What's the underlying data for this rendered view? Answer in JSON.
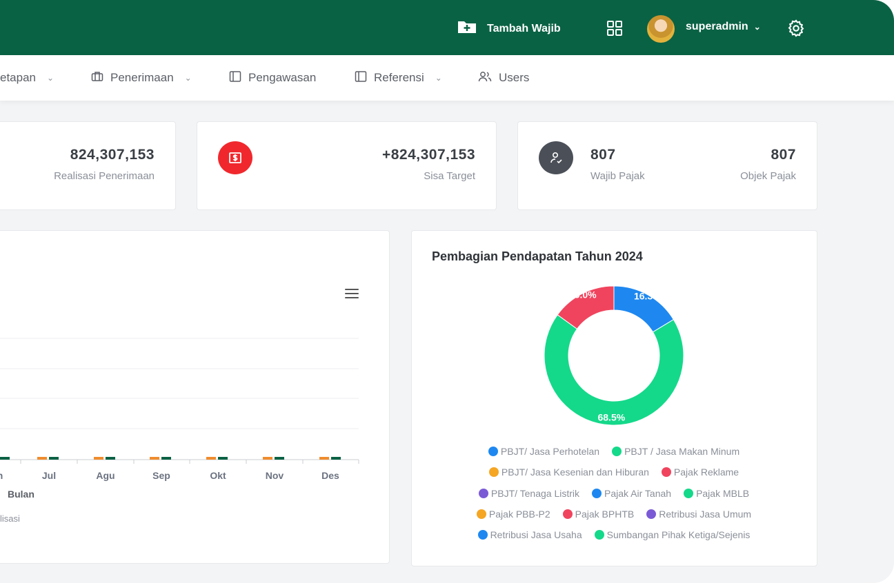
{
  "header": {
    "add_label": "Tambah Wajib",
    "username": "superadmin",
    "colors": {
      "bar": "#0a6244"
    }
  },
  "nav": {
    "items": [
      {
        "label": "etapan",
        "icon": "chevron-down-icon"
      },
      {
        "label": "Penerimaan",
        "icon": "briefcase-icon"
      },
      {
        "label": "Pengawasan",
        "icon": "panel-icon"
      },
      {
        "label": "Referensi",
        "icon": "panel-icon"
      },
      {
        "label": "Users",
        "icon": "users-icon"
      }
    ]
  },
  "stats": {
    "realisasi_value": "824,307,153",
    "realisasi_label": "Realisasi Penerimaan",
    "sisa_value": "+824,307,153",
    "sisa_label": "Sisa Target",
    "wajib_value": "807",
    "wajib_label": "Wajib Pajak",
    "objek_value": "807",
    "objek_label": "Objek Pajak"
  },
  "bar_chart": {
    "xlabel": "Bulan",
    "legend_partial": "lisasi",
    "categories": [
      "n",
      "Jul",
      "Agu",
      "Sep",
      "Okt",
      "Nov",
      "Des"
    ],
    "series": [
      {
        "color": "#f08c2e",
        "values": [
          0,
          0,
          0,
          0,
          0,
          0,
          0
        ]
      },
      {
        "color": "#0a6244",
        "values": [
          0,
          0,
          0,
          0,
          0,
          0,
          0
        ]
      }
    ]
  },
  "chart_data": {
    "type": "pie",
    "title": "Pembagian Pendapatan Tahun 2024",
    "slices": [
      {
        "label": "PBJT/ Jasa Perhotelan",
        "value": 16.3,
        "display": "16.3%",
        "color": "#1e88f0"
      },
      {
        "label": "PBJT / Jasa Makan Minum",
        "value": 68.5,
        "display": "68.5%",
        "color": "#14d98a"
      },
      {
        "label": "Pajak Reklame",
        "value": 15.0,
        "display": "15.0%",
        "color": "#f0445e"
      }
    ],
    "legend": [
      {
        "label": "PBJT/ Jasa Perhotelan",
        "color": "#1e88f0"
      },
      {
        "label": "PBJT / Jasa Makan Minum",
        "color": "#14d98a"
      },
      {
        "label": "PBJT/ Jasa Kesenian dan Hiburan",
        "color": "#f5a623"
      },
      {
        "label": "Pajak Reklame",
        "color": "#f0445e"
      },
      {
        "label": "PBJT/ Tenaga Listrik",
        "color": "#7b5ad6"
      },
      {
        "label": "Pajak Air Tanah",
        "color": "#1e88f0"
      },
      {
        "label": "Pajak MBLB",
        "color": "#14d98a"
      },
      {
        "label": "Pajak PBB-P2",
        "color": "#f5a623"
      },
      {
        "label": "Pajak BPHTB",
        "color": "#f0445e"
      },
      {
        "label": "Retribusi Jasa Umum",
        "color": "#7b5ad6"
      },
      {
        "label": "Retribusi Jasa Usaha",
        "color": "#1e88f0"
      },
      {
        "label": "Sumbangan Pihak Ketiga/Sejenis",
        "color": "#14d98a"
      }
    ],
    "legend_placement": "bottom"
  }
}
